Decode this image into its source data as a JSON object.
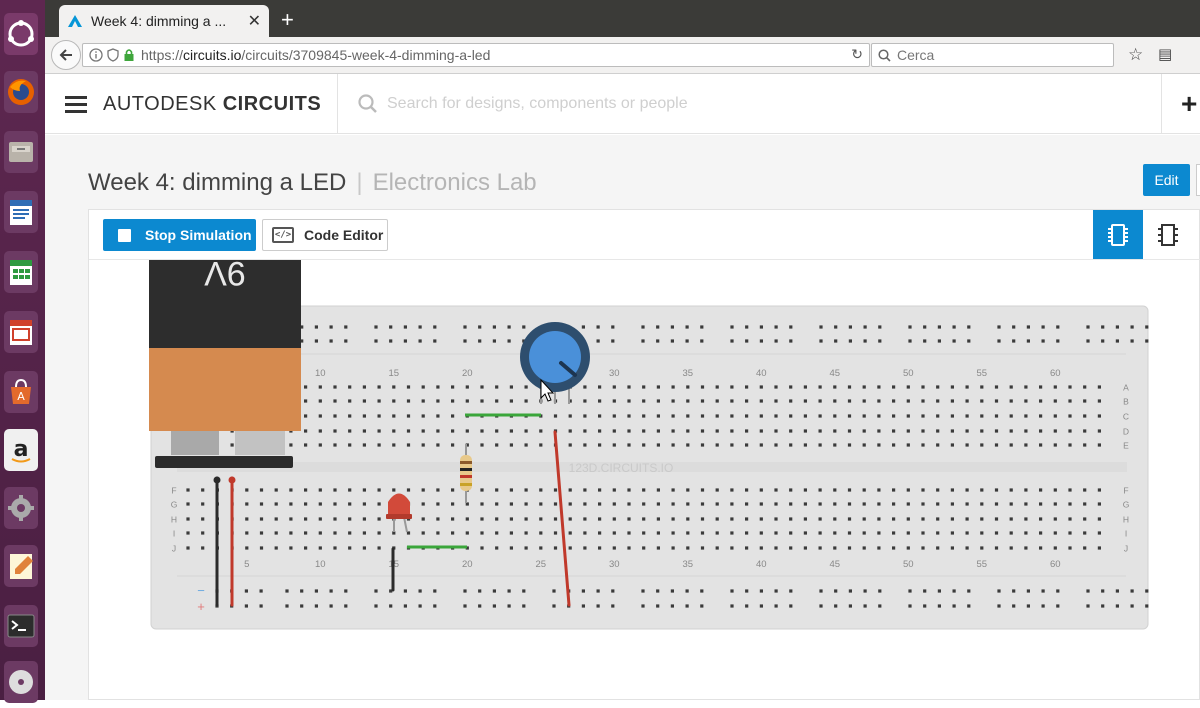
{
  "launcher": {
    "items": [
      "ubuntu-dash",
      "firefox",
      "files",
      "writer",
      "calc",
      "impress",
      "software-center",
      "amazon",
      "system-settings",
      "text-editor",
      "terminal",
      "dvd"
    ]
  },
  "browser": {
    "tab_title": "Week 4: dimming a ...",
    "url_domain": "circuits.io",
    "url_prefix": "https://",
    "url_path": "/circuits/3709845-week-4-dimming-a-led",
    "search_placeholder": "Cerca"
  },
  "app": {
    "brand_light": "AUTODESK",
    "brand_bold": "CIRCUITS",
    "search_placeholder": "Search for designs, components or people"
  },
  "project": {
    "title": "Week 4: dimming a LED",
    "separator": "|",
    "lab": "Electronics Lab",
    "edit_label": "Edit"
  },
  "toolbar": {
    "stop_label": "Stop Simulation",
    "code_label": "Code Editor"
  },
  "breadboard": {
    "watermark": "123D.CIRCUITS.IO",
    "battery_label": "9V",
    "column_numbers": [
      "5",
      "10",
      "15",
      "20",
      "25",
      "30",
      "35",
      "40",
      "45",
      "50",
      "55",
      "60"
    ],
    "row_letters_top": [
      "A",
      "B",
      "C",
      "D",
      "E"
    ],
    "row_letters_bottom": [
      "F",
      "G",
      "H",
      "I",
      "J"
    ],
    "rail_minus": "−",
    "rail_plus": "+"
  },
  "colors": {
    "accent": "#0c89d0",
    "breadboard": "#e3e3e3",
    "wire_red": "#c0392b",
    "wire_black": "#2b2b2b",
    "wire_green": "#3aa63a",
    "pot_blue": "#4a90d9",
    "battery_orange": "#d58a4f"
  }
}
